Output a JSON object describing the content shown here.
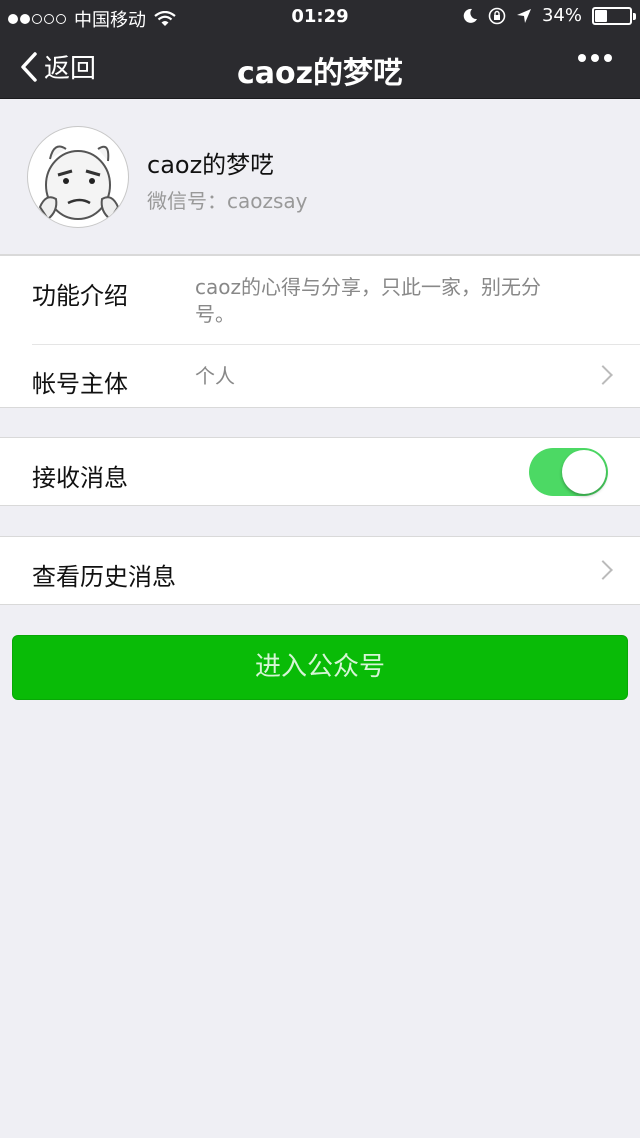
{
  "status_bar": {
    "carrier": "中国移动",
    "time": "01:29",
    "battery_text": "34%",
    "battery_level": 0.34,
    "signal_icon": "signal-dots-icon",
    "wifi_icon": "wifi-icon",
    "moon_icon": "moon-icon",
    "lock_icon": "orientation-lock-icon",
    "location_icon": "location-arrow-icon"
  },
  "nav": {
    "back_label": "返回",
    "title": "caoz的梦呓",
    "more_icon": "more-dots-icon"
  },
  "profile": {
    "name": "caoz的梦呓",
    "wechat_id": "微信号：caozsay"
  },
  "info": {
    "intro_label": "功能介绍",
    "intro_value": "caoz的心得与分享，只此一家，别无分号。",
    "account_label": "帐号主体",
    "account_value": "个人"
  },
  "messages": {
    "receive_label": "接收消息",
    "receive_on": true
  },
  "history": {
    "label": "查看历史消息"
  },
  "enter_button": "进入公众号",
  "colors": {
    "nav_bg": "#2b2b2f",
    "page_bg": "#efeff4",
    "toggle_on": "#4cd964",
    "button_green": "#09bb07"
  }
}
